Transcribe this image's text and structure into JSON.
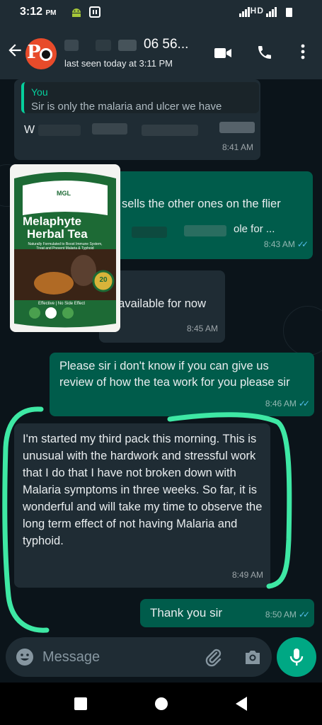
{
  "status_bar": {
    "time": "3:12",
    "ampm": "PM",
    "right_text": "HD"
  },
  "header": {
    "contact_number_visible": "06 56...",
    "last_seen": "last seen today at 3:11 PM",
    "avatar_text": "Po"
  },
  "messages": [
    {
      "direction": "incoming",
      "quote_author": "You",
      "quote_text": "Sir is only the malaria and ulcer we have",
      "text_visible": "W",
      "time": "8:41 AM"
    },
    {
      "direction": "outgoing",
      "text_line1": "sells the other ones on the flier",
      "text_line2": "ole for ...",
      "time": "8:43 AM",
      "read": true
    },
    {
      "direction": "incoming",
      "text": "t available for now",
      "time": "8:45 AM"
    },
    {
      "direction": "outgoing",
      "text": "Please sir i don't know if you can give us review of how the tea work for you please sir",
      "time": "8:46 AM",
      "read": true
    },
    {
      "direction": "incoming",
      "text": "I'm started my third pack this morning. This is unusual with the hardwork and stressful work that I do that I have not broken down with Malaria symptoms in three weeks. So far, it is wonderful and will take my time to observe the long term effect of not having Malaria and typhoid.",
      "time": "8:49 AM"
    },
    {
      "direction": "outgoing",
      "text": "Thank you sir",
      "time": "8:50 AM",
      "read": true
    }
  ],
  "product_image": {
    "brand": "MGL",
    "title_line1": "Melaphyte",
    "title_line2": "Herbal Tea",
    "subtitle": "Naturally Formulated to Boost Immune System, Treat and Prevent Malaria & Typhoid",
    "badge": "20",
    "footer": "Effective | No Side Effect"
  },
  "composer": {
    "placeholder": "Message"
  },
  "colors": {
    "background": "#0b141a",
    "incoming_bubble": "#1f2c34",
    "outgoing_bubble": "#005c4b",
    "accent": "#00a884",
    "read_ticks": "#53bdeb",
    "highlight_marker": "#3ee8a4"
  },
  "icons": [
    "back-arrow-icon",
    "video-call-icon",
    "phone-icon",
    "more-vert-icon",
    "emoji-icon",
    "attach-icon",
    "camera-icon",
    "mic-icon",
    "nav-home-icon",
    "nav-recents-icon",
    "nav-back-icon"
  ]
}
